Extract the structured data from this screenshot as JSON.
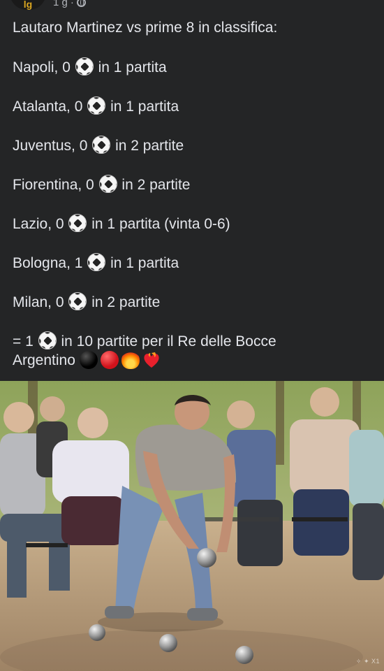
{
  "post": {
    "author_initials": "lg",
    "time": "1 g",
    "separator": "·",
    "privacy_icon": "globe-icon",
    "intro": "Lautaro Martinez vs prime 8 in classifica:",
    "stats": [
      {
        "before": "Napoli, 0",
        "after": "in 1 partita"
      },
      {
        "before": "Atalanta, 0",
        "after": "in 1 partita"
      },
      {
        "before": "Juventus, 0",
        "after": "in 2 partite"
      },
      {
        "before": "Fiorentina, 0",
        "after": "in 2 partite"
      },
      {
        "before": "Lazio, 0",
        "after": "in 1 partita (vinta 0-6)"
      },
      {
        "before": "Bologna, 1",
        "after": "in 1 partita"
      },
      {
        "before": "Milan, 0",
        "after": "in 2 partite"
      }
    ],
    "summary_before": "= 1",
    "summary_after": "in 10 partite per il Re delle Bocce",
    "summary_line2": "Argentino",
    "emojis": [
      "black-circle",
      "red-circle",
      "fire-emoji",
      "heart-on-fire-emoji"
    ],
    "watermark": "✧ ✦ X1"
  },
  "colors": {
    "background": "#242526",
    "text": "#e4e6eb",
    "meta": "#b0b3b8"
  }
}
